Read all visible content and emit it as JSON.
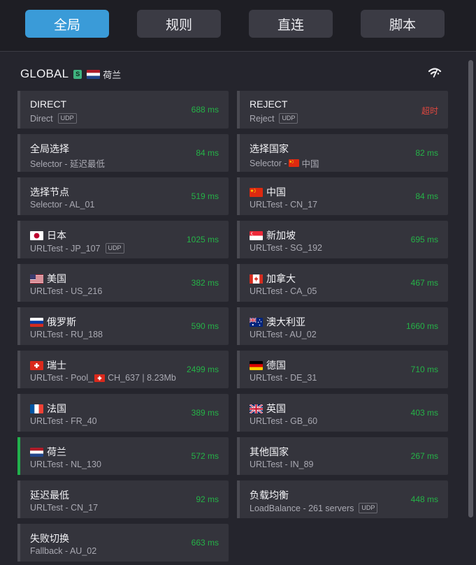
{
  "tabs": [
    "全局",
    "规则",
    "直连",
    "脚本"
  ],
  "group": {
    "name": "GLOBAL",
    "badge": "S",
    "selected": "荷兰",
    "selected_flag": "nl"
  },
  "proxies": [
    {
      "name": "DIRECT",
      "flag": "",
      "type": "Direct",
      "udp": "UDP",
      "delay": "688 ms"
    },
    {
      "name": "REJECT",
      "flag": "",
      "type": "Reject",
      "udp": "UDP",
      "delay": "超时",
      "timeout": true
    },
    {
      "name": "全局选择",
      "flag": "",
      "type": "Selector - 延迟最低",
      "delay": "84 ms"
    },
    {
      "name": "选择国家",
      "flag": "",
      "type": "Selector - ",
      "sub_flag": "cn",
      "sub_tail": "中国",
      "delay": "82 ms"
    },
    {
      "name": "选择节点",
      "flag": "",
      "type": "Selector - AL_01",
      "delay": "519 ms"
    },
    {
      "name": "中国",
      "flag": "cn",
      "type": "URLTest - CN_17",
      "delay": "84 ms"
    },
    {
      "name": "日本",
      "flag": "jp",
      "type": "URLTest - JP_107",
      "udp": "UDP",
      "delay": "1025 ms"
    },
    {
      "name": "新加坡",
      "flag": "sg",
      "type": "URLTest - SG_192",
      "delay": "695 ms"
    },
    {
      "name": "美国",
      "flag": "us",
      "type": "URLTest - US_216",
      "delay": "382 ms"
    },
    {
      "name": "加拿大",
      "flag": "ca",
      "type": "URLTest - CA_05",
      "delay": "467 ms"
    },
    {
      "name": "俄罗斯",
      "flag": "ru",
      "type": "URLTest - RU_188",
      "delay": "590 ms"
    },
    {
      "name": "澳大利亚",
      "flag": "au",
      "type": "URLTest - AU_02",
      "delay": "1660 ms"
    },
    {
      "name": "瑞士",
      "flag": "ch",
      "type": "URLTest - Pool_",
      "sub_flag": "ch",
      "sub_tail": "CH_637 | 8.23Mb",
      "delay": "2499 ms"
    },
    {
      "name": "德国",
      "flag": "de",
      "type": "URLTest - DE_31",
      "delay": "710 ms"
    },
    {
      "name": "法国",
      "flag": "fr",
      "type": "URLTest - FR_40",
      "delay": "389 ms"
    },
    {
      "name": "英国",
      "flag": "gb",
      "type": "URLTest - GB_60",
      "delay": "403 ms"
    },
    {
      "name": "荷兰",
      "flag": "nl",
      "type": "URLTest - NL_130",
      "delay": "572 ms",
      "selected": true
    },
    {
      "name": "其他国家",
      "flag": "",
      "type": "URLTest - IN_89",
      "delay": "267 ms"
    },
    {
      "name": "延迟最低",
      "flag": "",
      "type": "URLTest - CN_17",
      "delay": "92 ms"
    },
    {
      "name": "负载均衡",
      "flag": "",
      "type": "LoadBalance - 261 servers",
      "udp": "UDP",
      "delay": "448 ms"
    },
    {
      "name": "失败切换",
      "flag": "",
      "type": "Fallback - AU_02",
      "delay": "663 ms"
    }
  ],
  "icons": {
    "network": "wifi-signal-icon"
  },
  "colors": {
    "active_tab": "#3a9bd8",
    "delay_ok": "#25b347",
    "delay_timeout": "#e0473f",
    "selected_marker": "#22b14c"
  }
}
